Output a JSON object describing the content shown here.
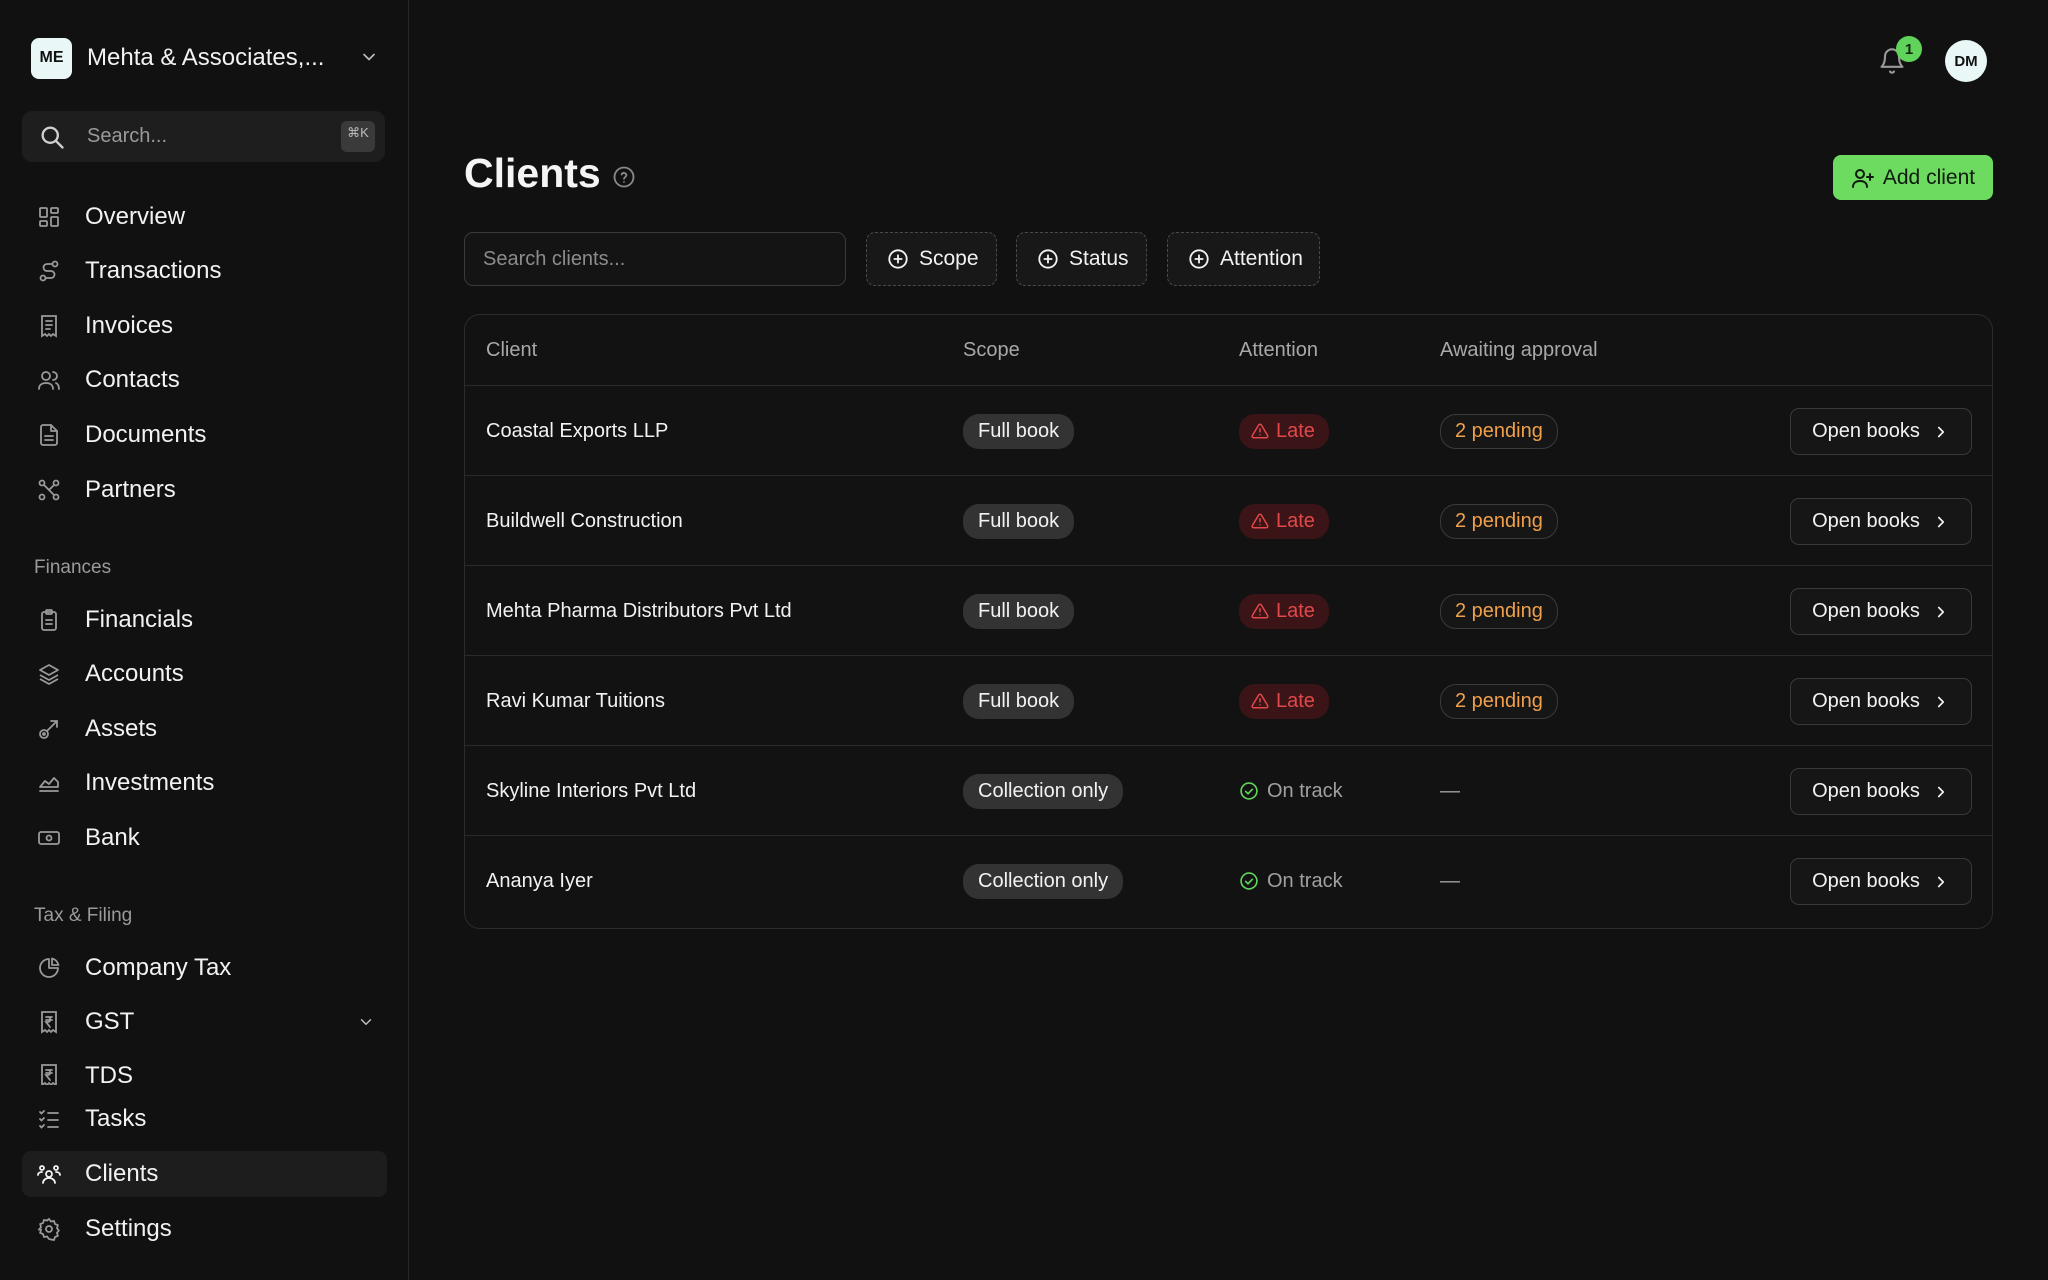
{
  "sidebar": {
    "org": {
      "initials": "ME",
      "name": "Mehta & Associates,..."
    },
    "search": {
      "placeholder": "Search...",
      "shortcut": "⌘K"
    },
    "primary": [
      {
        "label": "Overview",
        "icon": "grid-icon"
      },
      {
        "label": "Transactions",
        "icon": "route-icon"
      },
      {
        "label": "Invoices",
        "icon": "receipt-icon"
      },
      {
        "label": "Contacts",
        "icon": "users-icon"
      },
      {
        "label": "Documents",
        "icon": "file-text-icon"
      },
      {
        "label": "Partners",
        "icon": "network-icon"
      }
    ],
    "finances_label": "Finances",
    "finances": [
      {
        "label": "Financials",
        "icon": "clipboard-icon"
      },
      {
        "label": "Accounts",
        "icon": "layers-icon"
      },
      {
        "label": "Assets",
        "icon": "rocket-icon"
      },
      {
        "label": "Investments",
        "icon": "area-chart-icon"
      },
      {
        "label": "Bank",
        "icon": "banknote-icon"
      }
    ],
    "tax_label": "Tax & Filing",
    "tax": [
      {
        "label": "Company Tax",
        "icon": "pie-chart-icon"
      },
      {
        "label": "GST",
        "icon": "rupee-receipt-icon"
      },
      {
        "label": "TDS",
        "icon": "rupee-receipt-icon"
      }
    ],
    "bottom": [
      {
        "label": "Tasks",
        "icon": "list-checks-icon"
      },
      {
        "label": "Clients",
        "icon": "users-round-icon",
        "active": true
      },
      {
        "label": "Settings",
        "icon": "gear-icon"
      }
    ]
  },
  "topbar": {
    "notification_count": "1",
    "user_initials": "DM"
  },
  "main": {
    "title": "Clients",
    "add_client_label": "Add client",
    "search_placeholder": "Search clients...",
    "filters": [
      "Scope",
      "Status",
      "Attention"
    ]
  },
  "table": {
    "columns": [
      "Client",
      "Scope",
      "Attention",
      "Awaiting approval"
    ],
    "action_label": "Open books",
    "rows": [
      {
        "client": "Coastal Exports LLP",
        "scope": "Full book",
        "attention": "Late",
        "attention_state": "late",
        "awaiting": "2 pending"
      },
      {
        "client": "Buildwell Construction",
        "scope": "Full book",
        "attention": "Late",
        "attention_state": "late",
        "awaiting": "2 pending"
      },
      {
        "client": "Mehta Pharma Distributors Pvt Ltd",
        "scope": "Full book",
        "attention": "Late",
        "attention_state": "late",
        "awaiting": "2 pending"
      },
      {
        "client": "Ravi Kumar Tuitions",
        "scope": "Full book",
        "attention": "Late",
        "attention_state": "late",
        "awaiting": "2 pending"
      },
      {
        "client": "Skyline Interiors Pvt Ltd",
        "scope": "Collection only",
        "attention": "On track",
        "attention_state": "ok",
        "awaiting": "—"
      },
      {
        "client": "Ananya Iyer",
        "scope": "Collection only",
        "attention": "On track",
        "attention_state": "ok",
        "awaiting": "—"
      }
    ]
  },
  "colors": {
    "background": "#111111",
    "accent_green": "#6ddb5f",
    "late_red": "#e2484a",
    "pending_orange": "#f0a04a",
    "ok_green": "#5fd35a"
  }
}
